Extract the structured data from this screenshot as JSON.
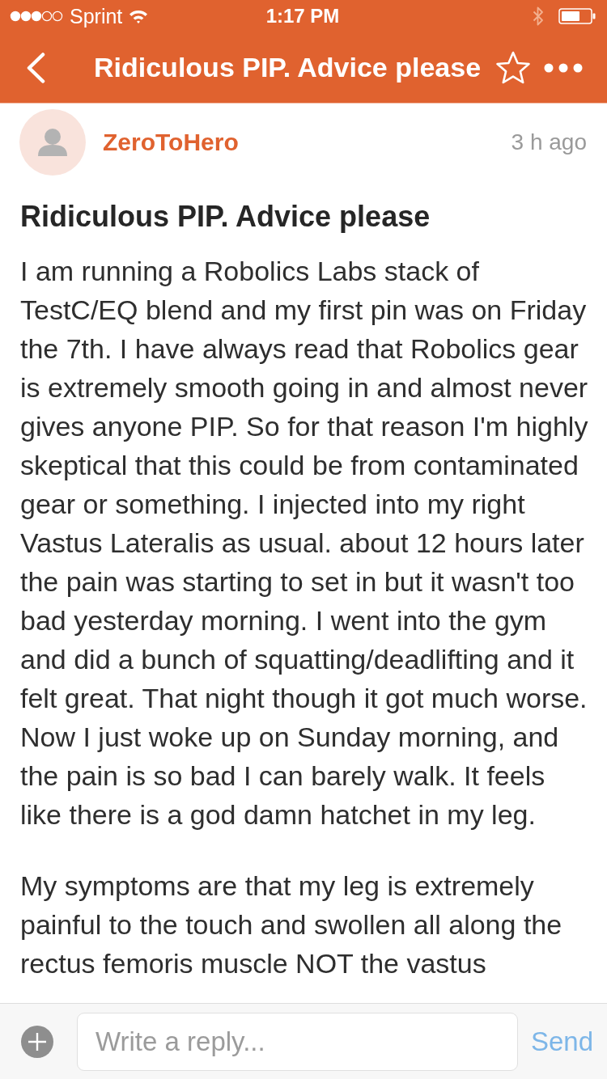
{
  "status_bar": {
    "carrier": "Sprint",
    "time": "1:17 PM"
  },
  "nav_bar": {
    "title": "Ridiculous PIP. Advice please",
    "favorited": false
  },
  "post": {
    "author": "ZeroToHero",
    "time": "3 h ago",
    "title": "Ridiculous PIP. Advice please",
    "paragraphs": [
      "I am running a Robolics Labs stack of TestC/EQ blend and my first pin was on Friday the 7th. I have always read that Robolics gear is extremely smooth going in and almost never gives anyone PIP. So for that reason I'm highly skeptical that this could be from contaminated gear or something. I injected into my right Vastus Lateralis as usual. about 12 hours later the pain was starting to set in but it wasn't too bad yesterday morning. I went into the gym and did a bunch of squatting/deadlifting and it felt great. That night though it got much worse. Now I just woke up on Sunday morning, and the pain is so bad I can barely walk. It feels like there is a god damn hatchet in my leg.",
      "My symptoms are that my leg is extremely painful to the touch and swollen all along the rectus femoris muscle NOT the vastus"
    ]
  },
  "composer": {
    "placeholder": "Write a reply...",
    "send_label": "Send"
  }
}
